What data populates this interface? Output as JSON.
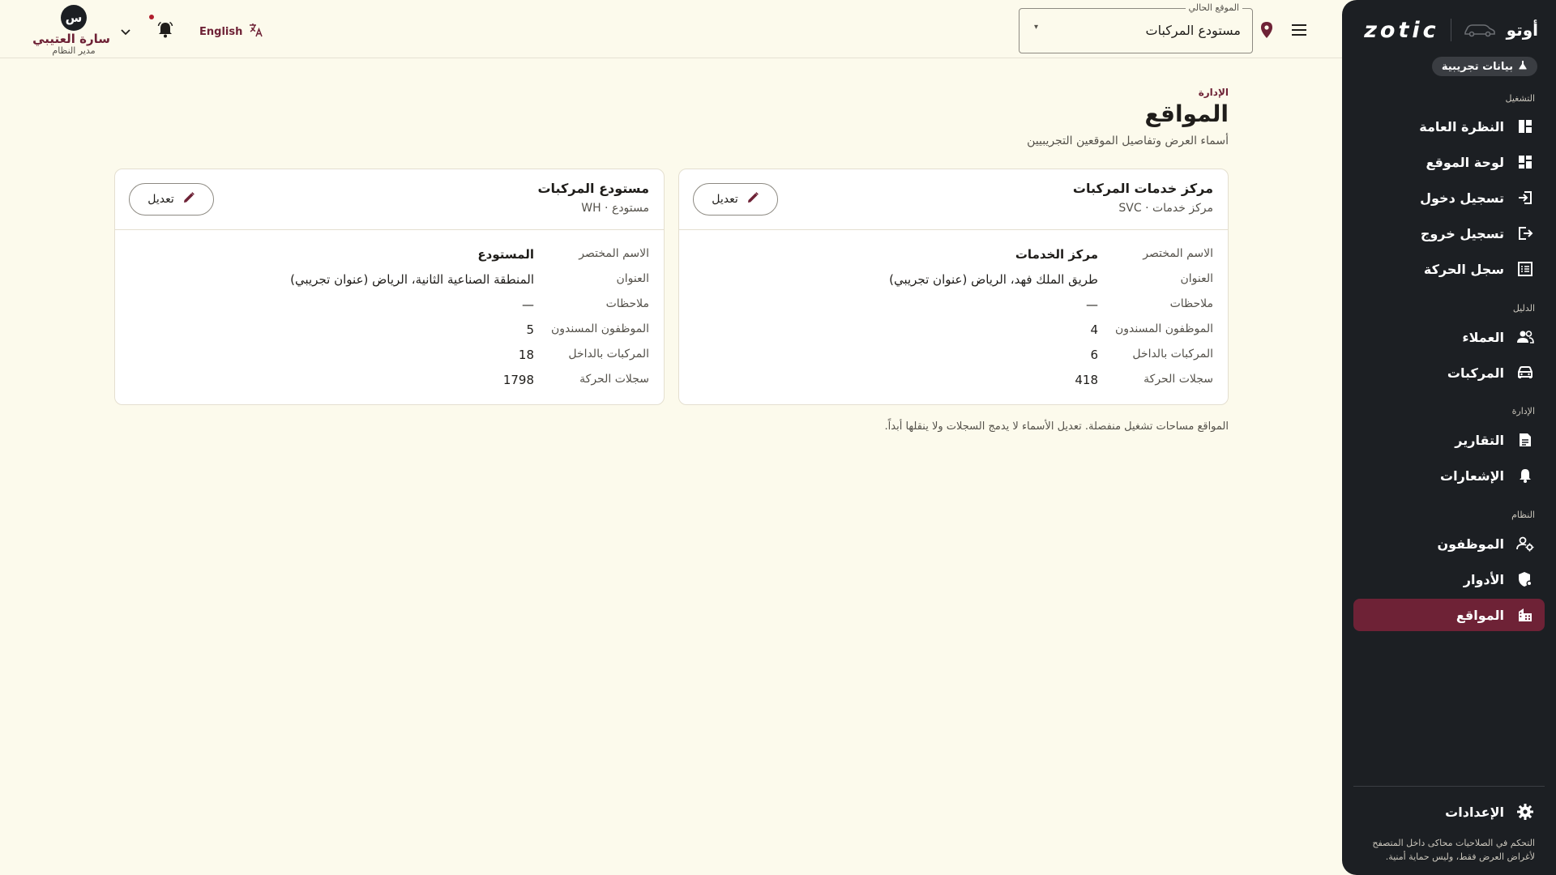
{
  "sidebar": {
    "brand_name": "أوتو",
    "logo_text": "zotic",
    "demo_badge": "بيانات تجريبية",
    "sections": {
      "operation": "التشغيل",
      "guide": "الدليل",
      "management": "الإدارة",
      "system": "النظام"
    },
    "items": [
      {
        "label": "النظرة العامة",
        "icon": "dashboard-icon"
      },
      {
        "label": "لوحة الموقع",
        "icon": "grid-icon"
      },
      {
        "label": "تسجيل دخول",
        "icon": "login-icon"
      },
      {
        "label": "تسجيل خروج",
        "icon": "logout-icon"
      },
      {
        "label": "سجل الحركة",
        "icon": "log-list-icon"
      },
      {
        "label": "العملاء",
        "icon": "people-icon"
      },
      {
        "label": "المركبات",
        "icon": "car-icon"
      },
      {
        "label": "التقارير",
        "icon": "report-icon"
      },
      {
        "label": "الإشعارات",
        "icon": "bell-icon"
      },
      {
        "label": "الموظفون",
        "icon": "staff-gear-icon"
      },
      {
        "label": "الأدوار",
        "icon": "shield-icon"
      },
      {
        "label": "المواقع",
        "icon": "building-icon"
      }
    ],
    "active_item": "المواقع",
    "settings_label": "الإعدادات",
    "footnote": "التحكم في الصلاحيات محاكى داخل المتصفح لأغراض العرض فقط، وليس حماية أمنية."
  },
  "topbar": {
    "location_legend": "الموقع الحالي",
    "location_value": "مستودع المركبات",
    "language_label": "English",
    "user": {
      "initial": "س",
      "name": "سارة العتيبي",
      "role": "مدير النظام"
    }
  },
  "main": {
    "eyebrow": "الإدارة",
    "title": "المواقع",
    "subtitle": "أسماء العرض وتفاصيل الموقعين التجريبيين",
    "edit_label": "تعديل",
    "field_labels": {
      "short_name": "الاسم المختصر",
      "address": "العنوان",
      "notes": "ملاحظات",
      "staff": "الموظفون المسندون",
      "vehicles_inside": "المركبات بالداخل",
      "movement_logs": "سجلات الحركة"
    },
    "cards": [
      {
        "title": "مركز خدمات المركبات",
        "subtitle": "مركز خدمات · SVC",
        "short_name": "مركز الخدمات",
        "address": "طريق الملك فهد، الرياض (عنوان تجريبي)",
        "notes": "—",
        "staff": "4",
        "vehicles_inside": "6",
        "movement_logs": "418"
      },
      {
        "title": "مستودع المركبات",
        "subtitle": "مستودع · WH",
        "short_name": "المستودع",
        "address": "المنطقة الصناعية الثانية، الرياض (عنوان تجريبي)",
        "notes": "—",
        "staff": "5",
        "vehicles_inside": "18",
        "movement_logs": "1798"
      }
    ],
    "footnote": "المواقع مساحات تشغيل منفصلة. تعديل الأسماء لا يدمج السجلات ولا ينقلها أبداً."
  },
  "colors": {
    "accent": "#6e2236",
    "sidebar_bg": "#1c1f23",
    "page_bg": "#fcfaec",
    "alert_dot": "#b01e2d"
  }
}
